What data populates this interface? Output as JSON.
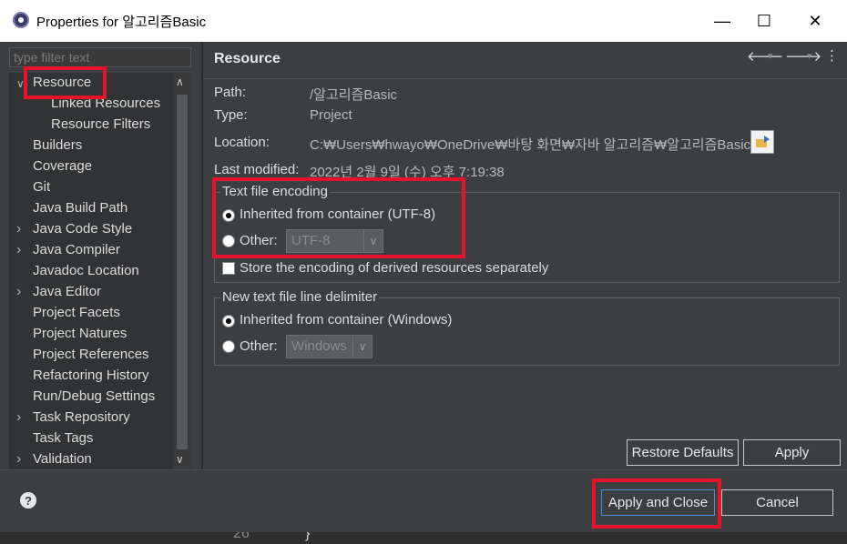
{
  "window": {
    "title": "Properties for 알고리즘Basic",
    "min_glyph": "—",
    "max_glyph": "☐",
    "close_glyph": "✕"
  },
  "editor": {
    "line_number": "26",
    "brace": "}"
  },
  "filter": {
    "placeholder": "type filter text"
  },
  "tree": {
    "items": [
      {
        "label": "Resource",
        "expanded": true,
        "selected": true
      },
      {
        "label": "Linked Resources",
        "child": true
      },
      {
        "label": "Resource Filters",
        "child": true
      },
      {
        "label": "Builders"
      },
      {
        "label": "Coverage"
      },
      {
        "label": "Git"
      },
      {
        "label": "Java Build Path"
      },
      {
        "label": "Java Code Style",
        "expandable": true
      },
      {
        "label": "Java Compiler",
        "expandable": true
      },
      {
        "label": "Javadoc Location"
      },
      {
        "label": "Java Editor",
        "expandable": true
      },
      {
        "label": "Project Facets"
      },
      {
        "label": "Project Natures"
      },
      {
        "label": "Project References"
      },
      {
        "label": "Refactoring History"
      },
      {
        "label": "Run/Debug Settings"
      },
      {
        "label": "Task Repository",
        "expandable": true
      },
      {
        "label": "Task Tags"
      },
      {
        "label": "Validation",
        "expandable": true
      }
    ]
  },
  "page": {
    "title": "Resource",
    "nav": {
      "back": "🡐",
      "forward": "🡒",
      "dropdown": "▾",
      "menu": "⋮"
    },
    "path_label": "Path:",
    "path_value": "/알고리즘Basic",
    "type_label": "Type:",
    "type_value": "Project",
    "location_label": "Location:",
    "location_value": "C:₩Users₩hwayo₩OneDrive₩바탕 화면₩자바 알고리즘₩알고리즘Basic",
    "modified_label": "Last modified:",
    "modified_value": "2022년 2월 9일 (수) 오후 7:19:38"
  },
  "encoding": {
    "group_title": "Text file encoding",
    "inherited_label": "Inherited from container (UTF-8)",
    "other_label": "Other:",
    "other_value": "UTF-8",
    "store_label": "Store the encoding of derived resources separately"
  },
  "delimiter": {
    "group_title": "New text file line delimiter",
    "inherited_label": "Inherited from container (Windows)",
    "other_label": "Other:",
    "other_value": "Windows"
  },
  "buttons": {
    "restore_defaults": "Restore Defaults",
    "apply": "Apply",
    "apply_and_close": "Apply and Close",
    "cancel": "Cancel"
  },
  "colors": {
    "highlight": "#e8132a",
    "dialog_bg": "#3c3f41"
  }
}
